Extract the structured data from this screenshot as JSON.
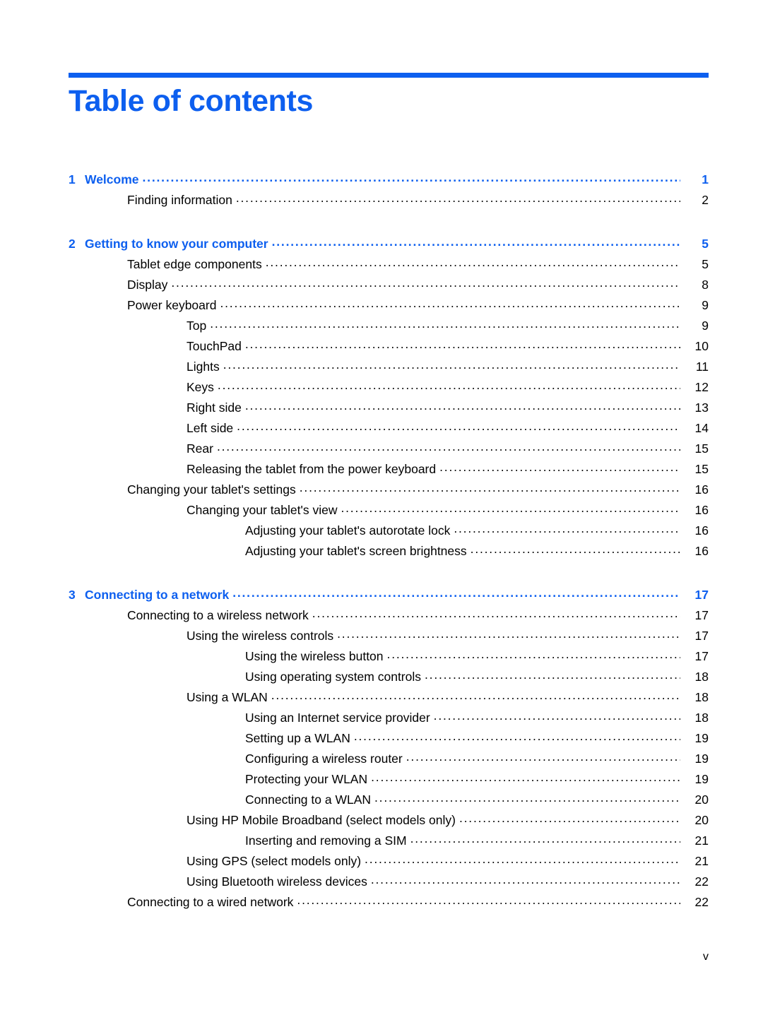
{
  "document": {
    "page_title": "Table of contents",
    "footer_page_number": "v",
    "accent_color": "#0d5fef"
  },
  "toc": {
    "entries": [
      {
        "level": 1,
        "number": "1",
        "label": "Welcome",
        "page": "1",
        "gap_before": false
      },
      {
        "level": 2,
        "number": "",
        "label": "Finding information",
        "page": "2",
        "gap_before": false
      },
      {
        "level": 1,
        "number": "2",
        "label": "Getting to know your computer",
        "page": "5",
        "gap_before": true
      },
      {
        "level": 2,
        "number": "",
        "label": "Tablet edge components",
        "page": "5",
        "gap_before": false
      },
      {
        "level": 2,
        "number": "",
        "label": "Display",
        "page": "8",
        "gap_before": false
      },
      {
        "level": 2,
        "number": "",
        "label": "Power keyboard",
        "page": "9",
        "gap_before": false
      },
      {
        "level": 3,
        "number": "",
        "label": "Top",
        "page": "9",
        "gap_before": false
      },
      {
        "level": 3,
        "number": "",
        "label": "TouchPad",
        "page": "10",
        "gap_before": false
      },
      {
        "level": 3,
        "number": "",
        "label": "Lights",
        "page": "11",
        "gap_before": false
      },
      {
        "level": 3,
        "number": "",
        "label": "Keys",
        "page": "12",
        "gap_before": false
      },
      {
        "level": 3,
        "number": "",
        "label": "Right side",
        "page": "13",
        "gap_before": false
      },
      {
        "level": 3,
        "number": "",
        "label": "Left side",
        "page": "14",
        "gap_before": false
      },
      {
        "level": 3,
        "number": "",
        "label": "Rear",
        "page": "15",
        "gap_before": false
      },
      {
        "level": 3,
        "number": "",
        "label": "Releasing the tablet from the power keyboard",
        "page": "15",
        "gap_before": false
      },
      {
        "level": 2,
        "number": "",
        "label": "Changing your tablet's settings",
        "page": "16",
        "gap_before": false
      },
      {
        "level": 3,
        "number": "",
        "label": "Changing your tablet's view",
        "page": "16",
        "gap_before": false
      },
      {
        "level": 4,
        "number": "",
        "label": "Adjusting your tablet's autorotate lock",
        "page": "16",
        "gap_before": false
      },
      {
        "level": 4,
        "number": "",
        "label": "Adjusting your tablet's screen brightness",
        "page": "16",
        "gap_before": false
      },
      {
        "level": 1,
        "number": "3",
        "label": "Connecting to a network",
        "page": "17",
        "gap_before": true
      },
      {
        "level": 2,
        "number": "",
        "label": "Connecting to a wireless network",
        "page": "17",
        "gap_before": false
      },
      {
        "level": 3,
        "number": "",
        "label": "Using the wireless controls",
        "page": "17",
        "gap_before": false
      },
      {
        "level": 4,
        "number": "",
        "label": "Using the wireless button",
        "page": "17",
        "gap_before": false
      },
      {
        "level": 4,
        "number": "",
        "label": "Using operating system controls",
        "page": "18",
        "gap_before": false
      },
      {
        "level": 3,
        "number": "",
        "label": "Using a WLAN",
        "page": "18",
        "gap_before": false
      },
      {
        "level": 4,
        "number": "",
        "label": "Using an Internet service provider",
        "page": "18",
        "gap_before": false
      },
      {
        "level": 4,
        "number": "",
        "label": "Setting up a WLAN",
        "page": "19",
        "gap_before": false
      },
      {
        "level": 4,
        "number": "",
        "label": "Configuring a wireless router",
        "page": "19",
        "gap_before": false
      },
      {
        "level": 4,
        "number": "",
        "label": "Protecting your WLAN",
        "page": "19",
        "gap_before": false
      },
      {
        "level": 4,
        "number": "",
        "label": "Connecting to a WLAN",
        "page": "20",
        "gap_before": false
      },
      {
        "level": 3,
        "number": "",
        "label": "Using HP Mobile Broadband (select models only)",
        "page": "20",
        "gap_before": false
      },
      {
        "level": 4,
        "number": "",
        "label": "Inserting and removing a SIM",
        "page": "21",
        "gap_before": false
      },
      {
        "level": 3,
        "number": "",
        "label": "Using GPS (select models only)",
        "page": "21",
        "gap_before": false
      },
      {
        "level": 3,
        "number": "",
        "label": "Using Bluetooth wireless devices",
        "page": "22",
        "gap_before": false
      },
      {
        "level": 2,
        "number": "",
        "label": "Connecting to a wired network",
        "page": "22",
        "gap_before": false
      }
    ]
  }
}
